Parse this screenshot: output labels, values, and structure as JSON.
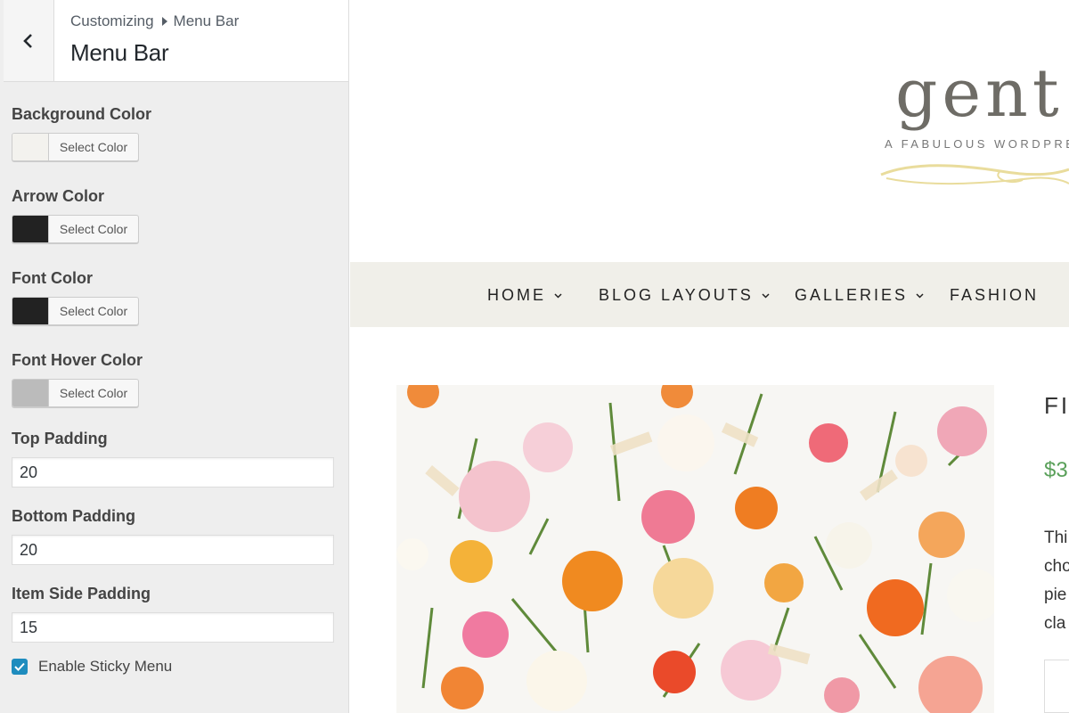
{
  "customizer": {
    "breadcrumb": {
      "parent": "Customizing",
      "current": "Menu Bar"
    },
    "title": "Menu Bar",
    "color_controls": [
      {
        "label": "Background Color",
        "button": "Select Color",
        "swatch": "#f3f2ee"
      },
      {
        "label": "Arrow Color",
        "button": "Select Color",
        "swatch": "#222222"
      },
      {
        "label": "Font Color",
        "button": "Select Color",
        "swatch": "#222222"
      },
      {
        "label": "Font Hover Color",
        "button": "Select Color",
        "swatch": "#bbbbbb"
      }
    ],
    "text_controls": [
      {
        "label": "Top Padding",
        "value": "20"
      },
      {
        "label": "Bottom Padding",
        "value": "20"
      },
      {
        "label": "Item Side Padding",
        "value": "15"
      }
    ],
    "sticky": {
      "label": "Enable Sticky Menu",
      "checked": true
    }
  },
  "site": {
    "logo": "gent",
    "tagline": "A FABULOUS WORDPRE",
    "menu": [
      "HOME",
      "BLOG LAYOUTS",
      "GALLERIES",
      "FASHION"
    ],
    "product": {
      "title": "FI",
      "price": "$3",
      "desc_lines": [
        "Thi",
        "cho",
        "pie",
        "cla"
      ]
    }
  },
  "colors": {
    "accent": "#1e8cbe",
    "menubar": "#f0efe9",
    "price": "#5aa05a",
    "flourish": "#e9dc9c"
  }
}
